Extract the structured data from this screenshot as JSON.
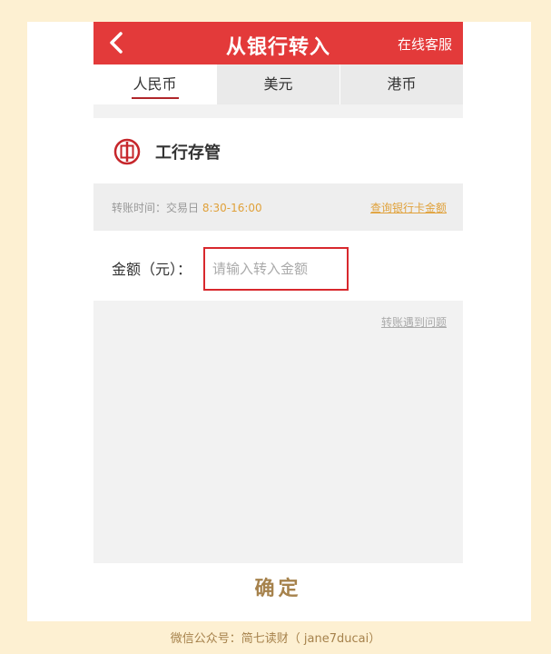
{
  "header": {
    "title": "从银行转入",
    "service_label": "在线客服"
  },
  "tabs": [
    {
      "label": "人民币",
      "active": true
    },
    {
      "label": "美元",
      "active": false
    },
    {
      "label": "港币",
      "active": false
    }
  ],
  "bank": {
    "name": "工行存管",
    "logo_icon": "icbc-logo-icon"
  },
  "transfer_time": {
    "label": "转账时间：交易日 ",
    "hours": "8:30-16:00",
    "query_link": "查询银行卡金额"
  },
  "amount": {
    "label": "金额（元）：",
    "placeholder": "请输入转入金额",
    "value": ""
  },
  "problem_link": "转账遇到问题",
  "confirm_label": "确定",
  "footer": "微信公众号：简七读财（ jane7ducai）",
  "colors": {
    "header_bg": "#e33a3a",
    "accent_gold": "#e0a13a",
    "confirm_text": "#a6824c",
    "page_bg": "#fdf0d2"
  }
}
